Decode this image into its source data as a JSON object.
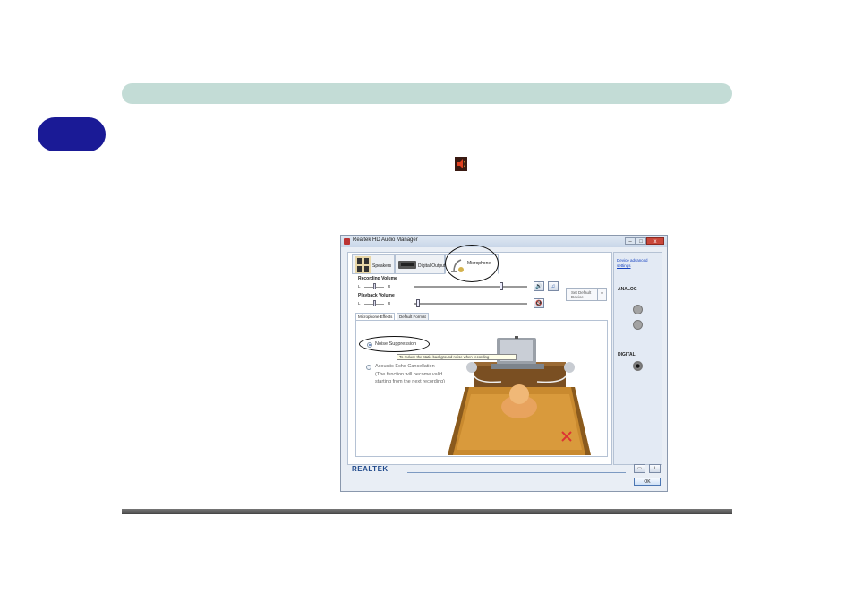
{
  "window": {
    "title": "Realtek HD Audio Manager",
    "buttons": {
      "minimize": "–",
      "maximize": "□",
      "close": "x"
    }
  },
  "device_tabs": [
    {
      "label": "Speakers",
      "icon": "speakers-icon"
    },
    {
      "label": "Digital Output",
      "icon": "digital-output-icon"
    },
    {
      "label": "Microphone",
      "icon": "microphone-icon",
      "active": true
    }
  ],
  "recording_volume": {
    "label": "Recording Volume",
    "left": "L",
    "right": "R",
    "level": 0.78
  },
  "playback_volume": {
    "label": "Playback Volume",
    "left": "L",
    "right": "R",
    "level": 0.02
  },
  "default_device": {
    "label": "Set Default Device"
  },
  "sub_tabs": [
    "Microphone Effects",
    "Default Format"
  ],
  "effects": {
    "noise_suppression": "Noise Suppression",
    "tooltip": "To reduce the static background noise when recording",
    "aec": "Acoustic Echo Cancellation",
    "aec_note": "(The function will become valid starting from the next recording)"
  },
  "side": {
    "link": "Device advanced settings",
    "analog": "ANALOG",
    "digital": "DIGITAL"
  },
  "footer": {
    "brand": "REALTEK",
    "ok": "OK"
  },
  "colors": {
    "topbar": "#c3dcd6",
    "chapter_pill": "#1a1a96",
    "link": "#1542c0"
  }
}
